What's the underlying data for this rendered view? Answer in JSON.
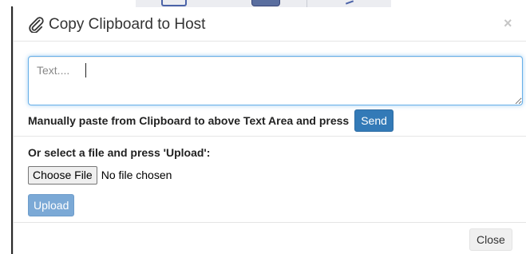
{
  "modal": {
    "title": "Copy Clipboard to Host",
    "title_icon": "paperclip-icon",
    "close_symbol": "×",
    "close_icon": "close-icon"
  },
  "text_area": {
    "placeholder": "Text...."
  },
  "paste_section": {
    "instruction": "Manually paste from Clipboard to above Text Area and press",
    "send_label": "Send"
  },
  "upload_section": {
    "instruction": "Or select a file and press 'Upload':",
    "choose_file_label": "Choose File",
    "file_status": "No file chosen",
    "upload_label": "Upload"
  },
  "footer": {
    "close_label": "Close"
  },
  "colors": {
    "primary": "#337ab7",
    "primary_disabled": "#7ba9d6",
    "focus_border": "#66afe9"
  }
}
